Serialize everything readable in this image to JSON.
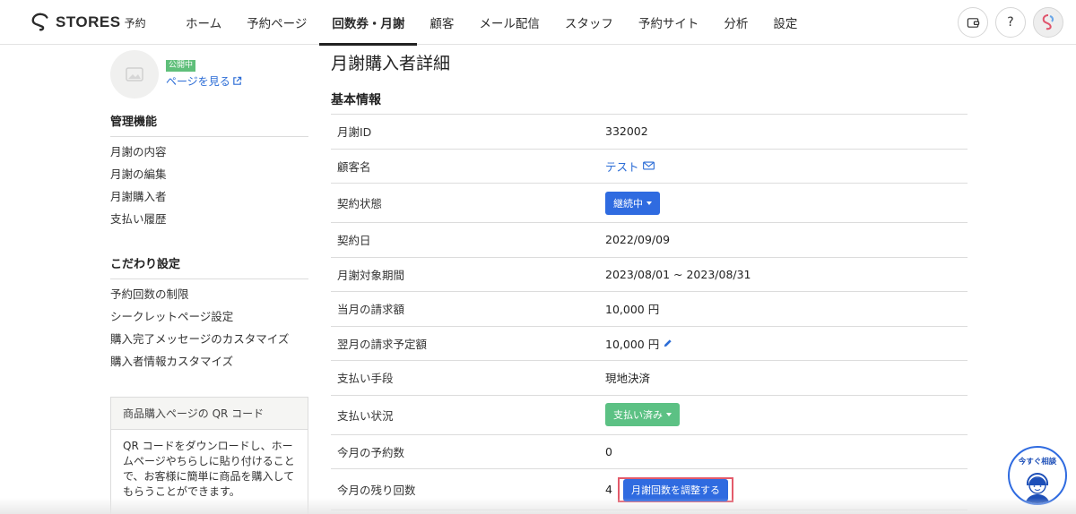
{
  "brand": {
    "name": "STORES",
    "sub": "予約"
  },
  "nav": [
    {
      "label": "ホーム",
      "active": false
    },
    {
      "label": "予約ページ",
      "active": false
    },
    {
      "label": "回数券・月謝",
      "active": true
    },
    {
      "label": "顧客",
      "active": false
    },
    {
      "label": "メール配信",
      "active": false
    },
    {
      "label": "スタッフ",
      "active": false
    },
    {
      "label": "予約サイト",
      "active": false
    },
    {
      "label": "分析",
      "active": false
    },
    {
      "label": "設定",
      "active": false
    }
  ],
  "top_icons": {
    "help": "?"
  },
  "sidebar": {
    "status_badge": "公開中",
    "page_link": "ページを見る",
    "management_title": "管理機能",
    "management_items": [
      "月謝の内容",
      "月謝の編集",
      "月謝購入者",
      "支払い履歴"
    ],
    "custom_title": "こだわり設定",
    "custom_items": [
      "予約回数の制限",
      "シークレットページ設定",
      "購入完了メッセージのカスタマイズ",
      "購入者情報カスタマイズ"
    ],
    "qr": {
      "title": "商品購入ページの QR コード",
      "desc_lines": [
        "QR コードをダウンロードし、ホー",
        "ムページやちらしに貼り付けること",
        "で、お客様に簡単に商品を購入して",
        "もらうことができます。"
      ]
    }
  },
  "main": {
    "title": "月謝購入者詳細",
    "section": "基本情報",
    "rows": {
      "id": {
        "label": "月謝ID",
        "value": "332002"
      },
      "customer": {
        "label": "顧客名",
        "value": "テスト"
      },
      "contract_status": {
        "label": "契約状態",
        "value": "継続中"
      },
      "contract_date": {
        "label": "契約日",
        "value": "2022/09/09"
      },
      "period": {
        "label": "月謝対象期間",
        "value": "2023/08/01 ~ 2023/08/31"
      },
      "this_month_amount": {
        "label": "当月の請求額",
        "value": "10,000 円"
      },
      "next_month_amount": {
        "label": "翌月の請求予定額",
        "value": "10,000 円"
      },
      "payment_method": {
        "label": "支払い手段",
        "value": "現地決済"
      },
      "payment_status": {
        "label": "支払い状況",
        "value": "支払い済み"
      },
      "reservations": {
        "label": "今月の予約数",
        "value": "0"
      },
      "remaining": {
        "label": "今月の残り回数",
        "value": "4",
        "button": "月謝回数を調整する"
      }
    }
  },
  "chat": {
    "label": "今すぐ相談"
  },
  "colors": {
    "accent": "#2f6be0",
    "success": "#5cc184",
    "highlight": "#e35a6a"
  }
}
